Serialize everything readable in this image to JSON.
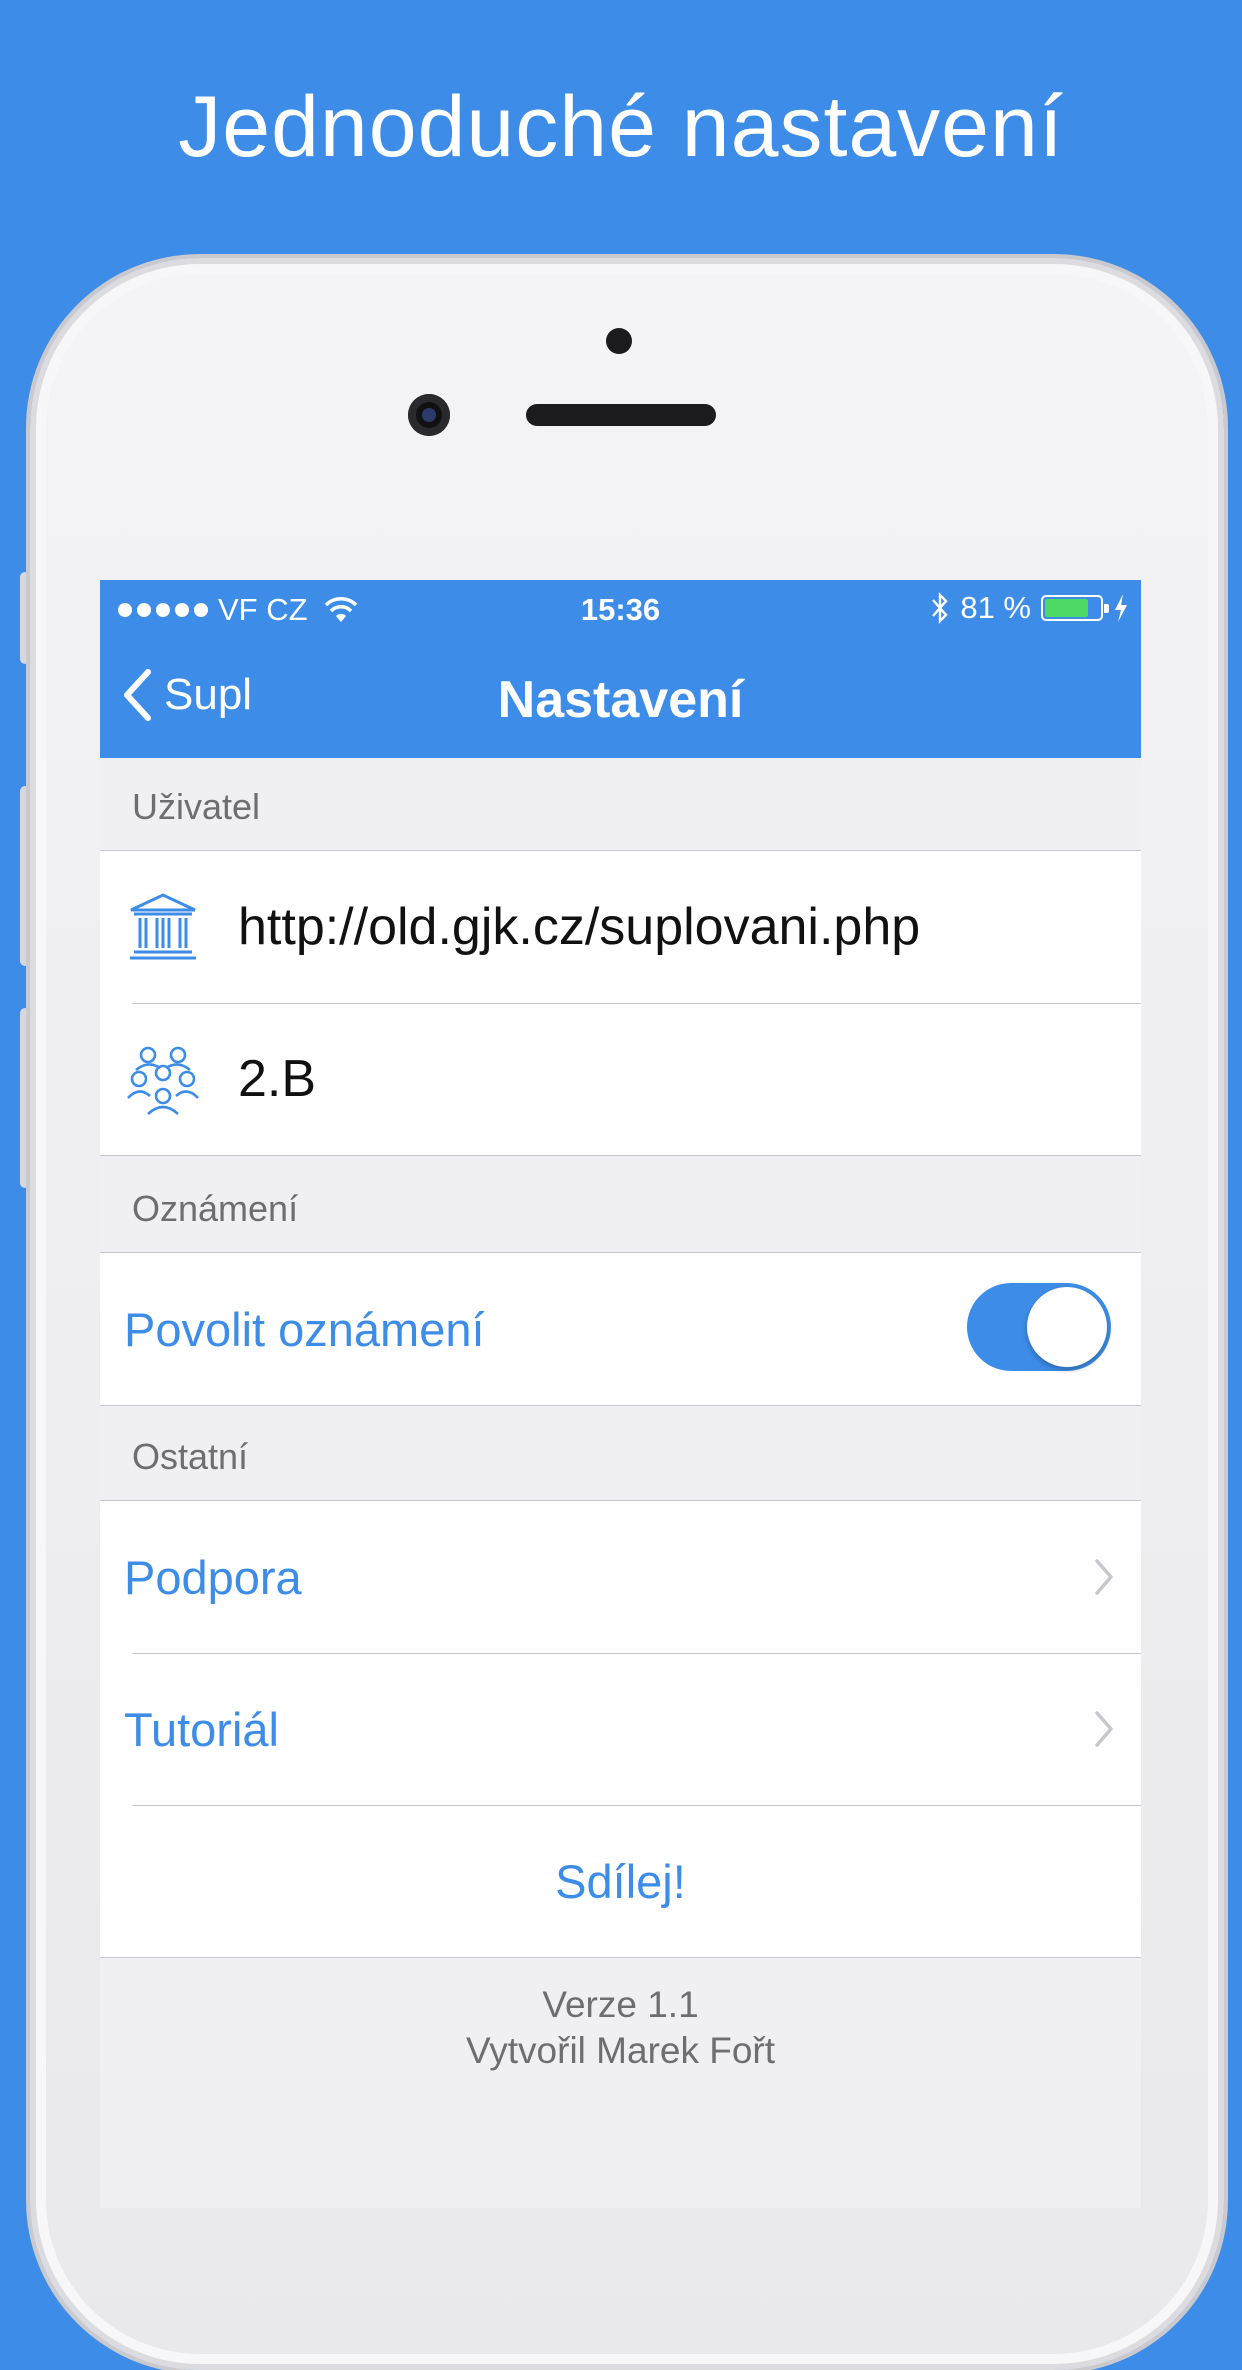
{
  "headline": "Jednoduché nastavení",
  "status_bar": {
    "carrier": "VF CZ",
    "time": "15:36",
    "battery_text": "81 %",
    "battery_level": 0.81
  },
  "nav": {
    "back_label": "Supl",
    "title": "Nastavení"
  },
  "sections": {
    "user": {
      "header": "Uživatel",
      "school_url": "http://old.gjk.cz/suplovani.php",
      "class": "2.B"
    },
    "notifications": {
      "header": "Oznámení",
      "allow_label": "Povolit oznámení",
      "allow_enabled": true
    },
    "other": {
      "header": "Ostatní",
      "support_label": "Podpora",
      "tutorial_label": "Tutoriál",
      "share_label": "Sdílej!"
    }
  },
  "footer": {
    "version": "Verze 1.1",
    "author": "Vytvořil Marek Fořt"
  },
  "colors": {
    "accent": "#3D8DE8",
    "toggle_on": "#3D8DE8",
    "battery": "#4CD964"
  },
  "icons": {
    "school": "institution-icon",
    "class": "group-icon",
    "back": "chevron-left-icon",
    "disclosure": "chevron-right-icon"
  }
}
